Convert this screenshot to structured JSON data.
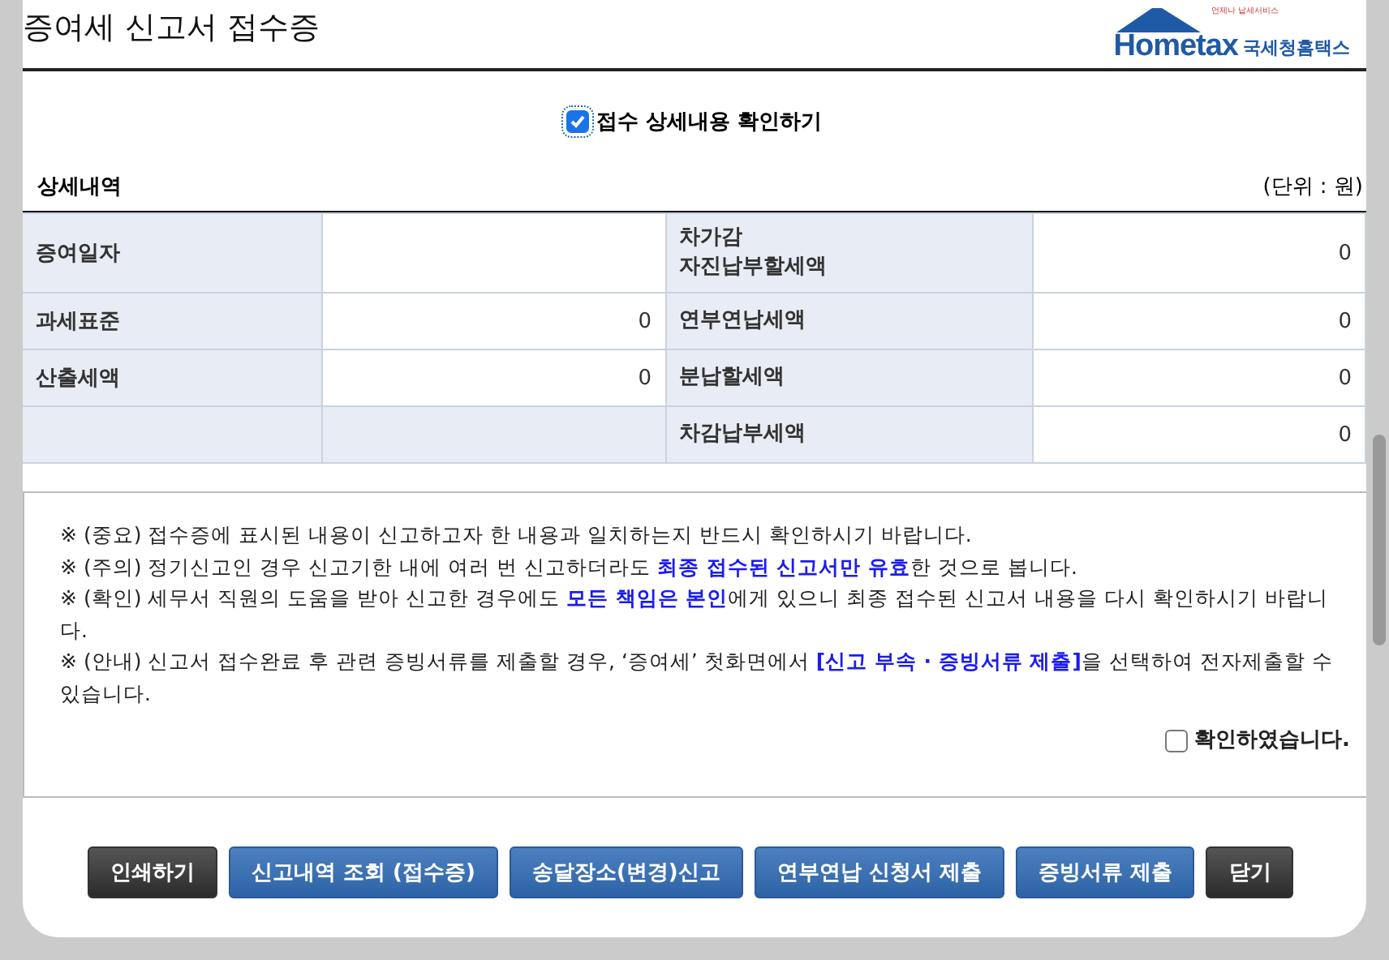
{
  "window": {
    "title": "증여세 신고서 접수증"
  },
  "logo": {
    "brand": "Hometax",
    "tagline": "국세청홈택스",
    "subtitle": "언제나 납세서비스"
  },
  "detail_toggle": {
    "label": "접수 상세내용 확인하기",
    "checked": true
  },
  "section": {
    "title": "상세내역",
    "unit": "(단위 : 원)"
  },
  "table": {
    "rows": [
      {
        "label_1": "증여일자",
        "value_1": "",
        "redacted": true,
        "label_2": "차가감\n자진납부할세액",
        "value_2": "0"
      },
      {
        "label_1": "과세표준",
        "value_1": "0",
        "redacted": false,
        "label_2": "연부연납세액",
        "value_2": "0"
      },
      {
        "label_1": "산출세액",
        "value_1": "0",
        "redacted": false,
        "label_2": "분납할세액",
        "value_2": "0"
      },
      {
        "label_1": "",
        "value_1": "",
        "redacted": false,
        "label_2": "차감납부세액",
        "value_2": "0"
      }
    ]
  },
  "notes": [
    "※ (중요) 접수증에 표시된 내용이 신고하고자 한 내용과 일치하는지 반드시 확인하시기 바랍니다.",
    "※ (주의) 정기신고인 경우 신고기한 내에 여러 번 신고하더라도 **최종 접수된 신고서만 유효**한 것으로 봅니다.",
    "※ (확인) 세무서 직원의 도움을 받아 신고한 경우에도 **모든 책임은 본인**에게 있으니 최종 접수된 신고서 내용을 다시 확인하시기 바랍니다.",
    "※ (안내) 신고서 접수완료 후 관련 증빙서류를 제출할 경우, ‘증여세’ 첫화면에서 **[신고 부속 · 증빙서류 제출]**을 선택하여 전자제출할 수 있습니다."
  ],
  "confirm": {
    "label": "확인하였습니다.",
    "checked": false
  },
  "buttons": [
    {
      "label": "인쇄하기",
      "kind": "dark"
    },
    {
      "label": "신고내역 조회 (접수증)",
      "kind": "blue"
    },
    {
      "label": "송달장소(변경)신고",
      "kind": "blue"
    },
    {
      "label": "연부연납 신청서 제출",
      "kind": "blue"
    },
    {
      "label": "증빙서류 제출",
      "kind": "blue"
    },
    {
      "label": "닫기",
      "kind": "dark"
    }
  ]
}
